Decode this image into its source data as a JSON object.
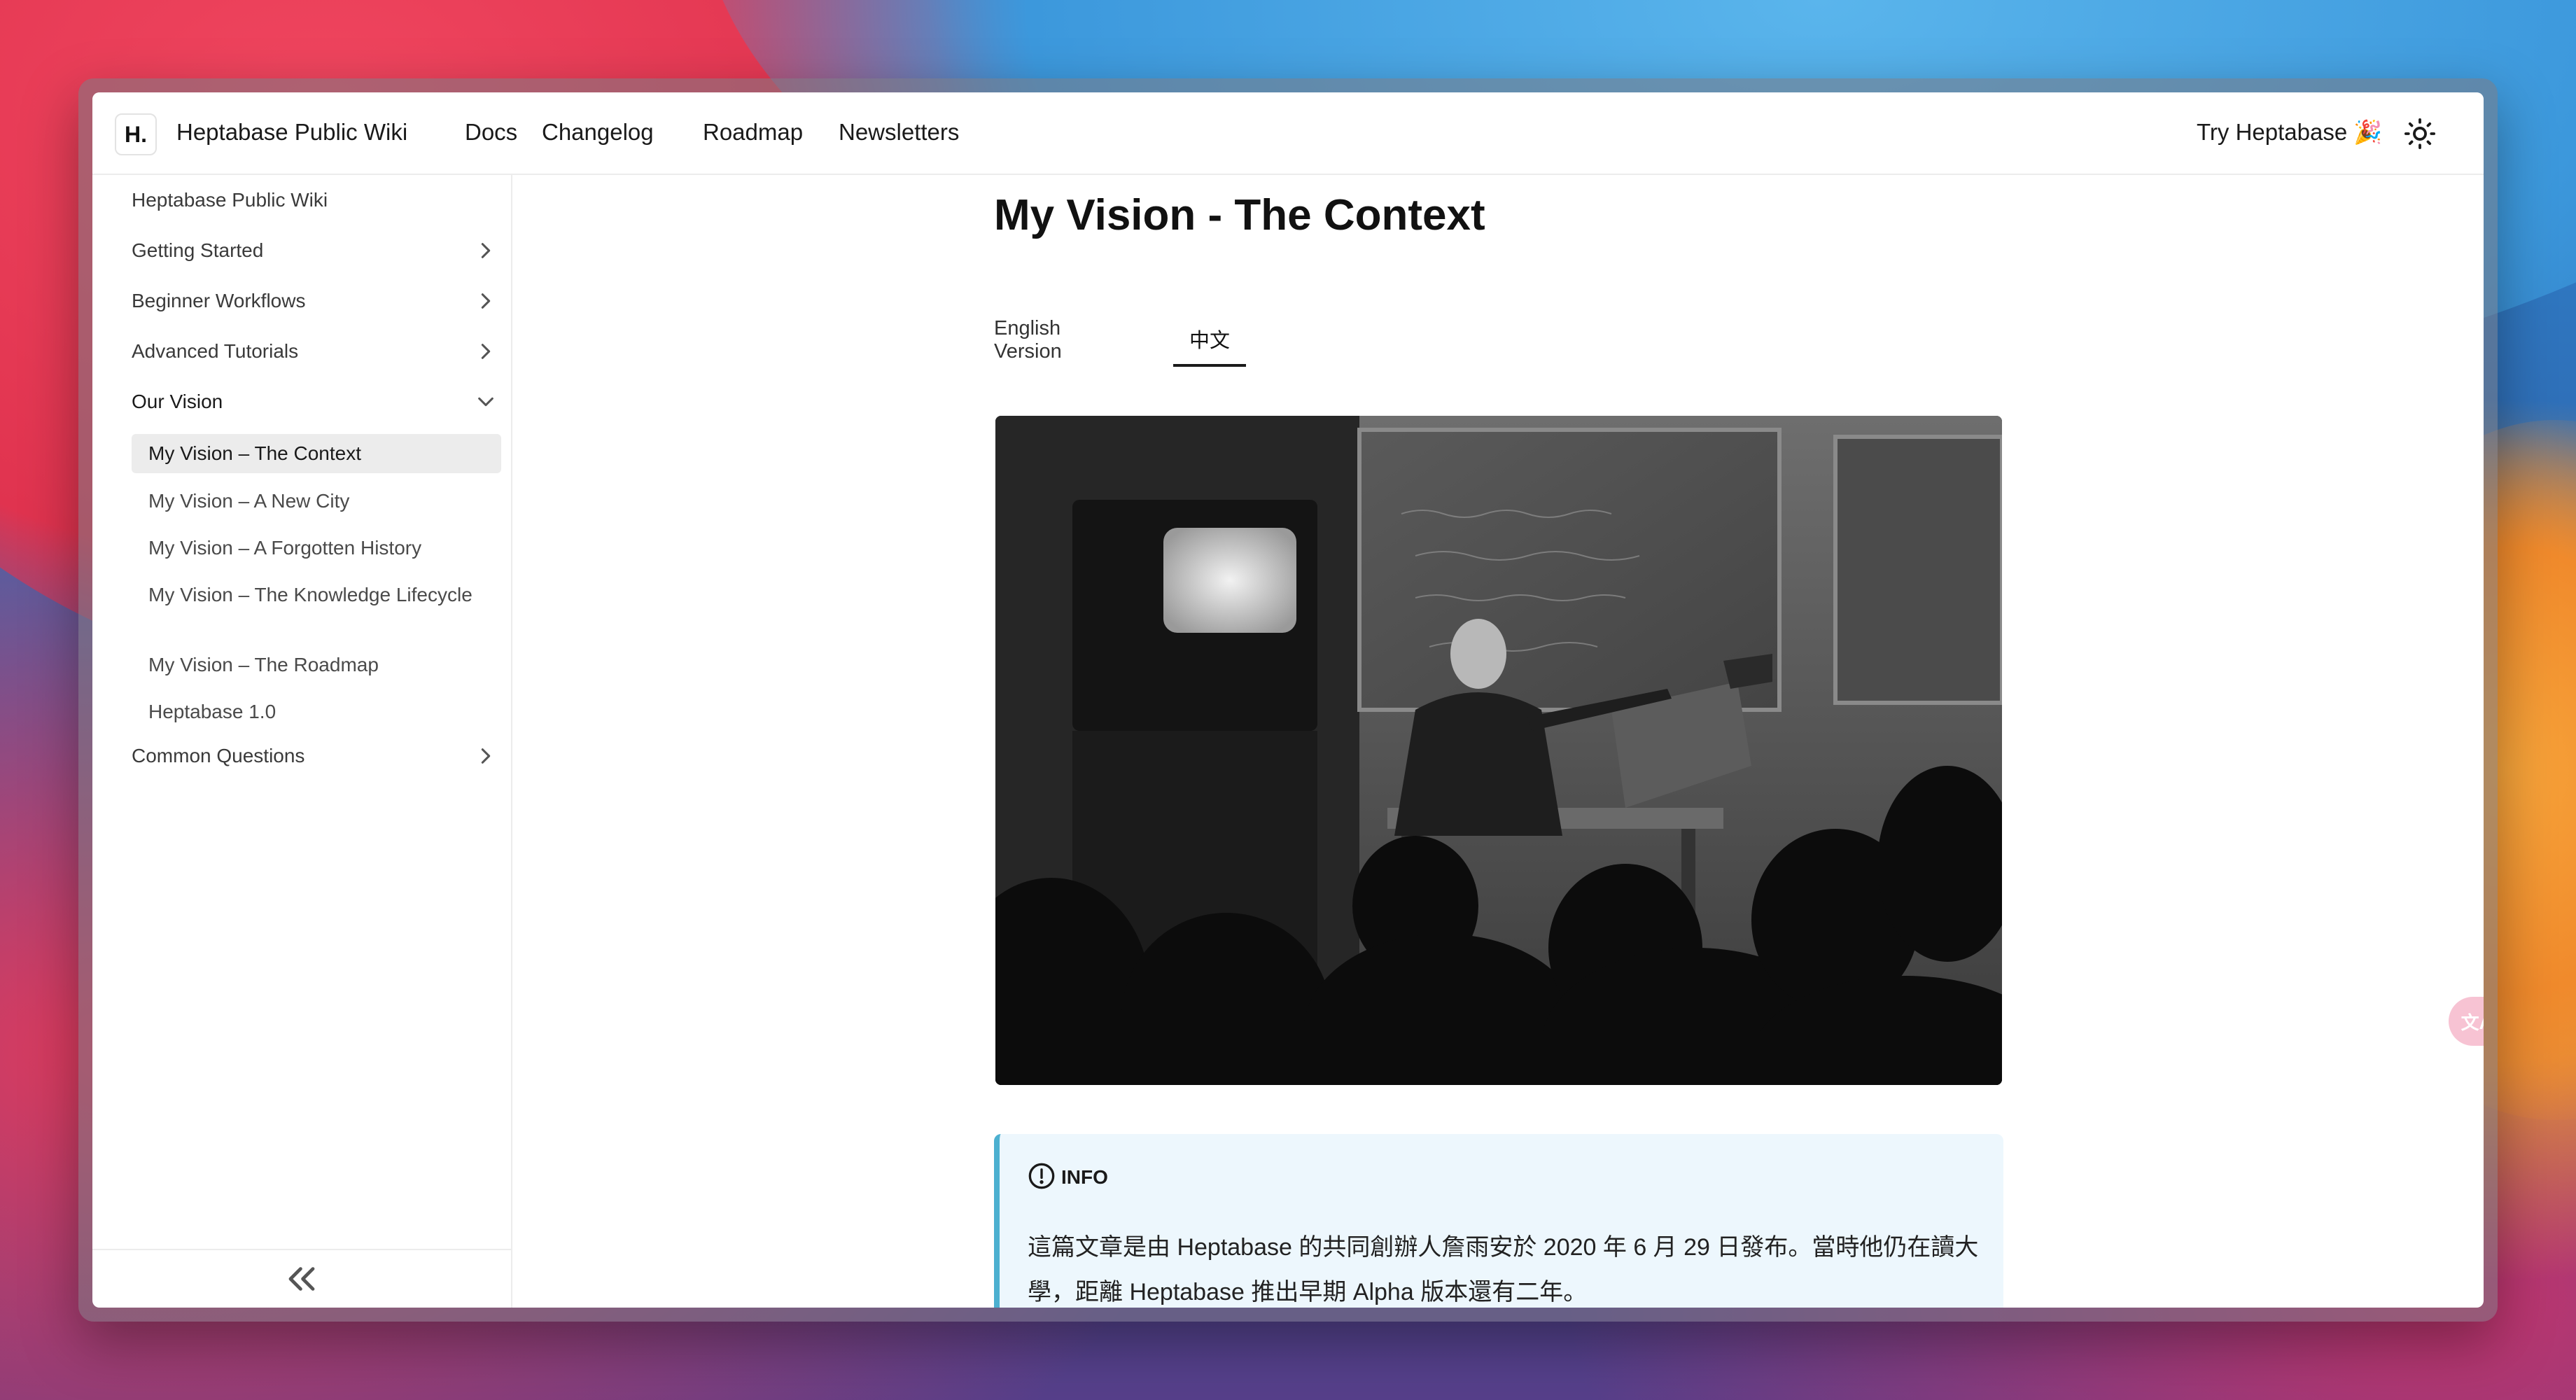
{
  "header": {
    "logo": "H.",
    "site_title": "Heptabase Public Wiki",
    "nav": [
      "Docs",
      "Changelog",
      "Roadmap",
      "Newsletters"
    ],
    "try_button": "Try Heptabase 🎉"
  },
  "sidebar": {
    "root": "Heptabase Public Wiki",
    "items": [
      {
        "label": "Getting Started",
        "state": "collapsed"
      },
      {
        "label": "Beginner Workflows",
        "state": "collapsed"
      },
      {
        "label": "Advanced Tutorials",
        "state": "collapsed"
      },
      {
        "label": "Our Vision",
        "state": "expanded"
      },
      {
        "label": "Common Questions",
        "state": "collapsed"
      }
    ],
    "sub_items": [
      "My Vision – The Context",
      "My Vision – A New City",
      "My Vision – A Forgotten History",
      "My Vision – The Knowledge Lifecycle",
      "My Vision – The Roadmap",
      "Heptabase 1.0"
    ],
    "active_sub": "My Vision – The Context",
    "collapse_icon": "double-chevron-left-icon"
  },
  "main": {
    "title": "My Vision - The Context",
    "tabs": [
      "English Version",
      "中文"
    ],
    "active_tab": "中文",
    "info": {
      "label": "INFO",
      "text": "這篇文章是由 Heptabase 的共同創辦人詹雨安於 2020 年 6 月 29 日發布。當時他仍在讀大學，距離 Heptabase 推出早期 Alpha 版本還有二年。"
    }
  },
  "translate_fab": "文A",
  "colors": {
    "info_bg": "#edf7fd",
    "info_border": "#4cb0d0",
    "active_sidebar_bg": "#ececec"
  }
}
